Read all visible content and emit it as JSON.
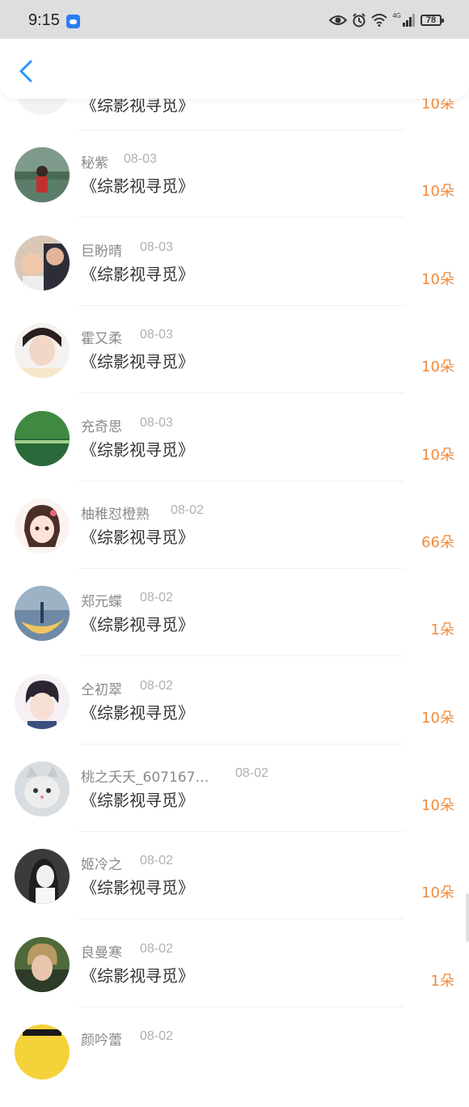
{
  "status_bar": {
    "time": "9:15",
    "battery": "78",
    "network": "4G"
  },
  "nav": {
    "back_icon": "chevron-left-icon"
  },
  "colors": {
    "accent": "#2a95ff",
    "amount": "#f08a3c",
    "name": "#8a8a8a",
    "date": "#b0b0b0"
  },
  "rows": [
    {
      "name": "",
      "date": "",
      "work": "《综影视寻觅》",
      "amount": "10朵"
    },
    {
      "name": "秘紫",
      "date": "08-03",
      "work": "《综影视寻觅》",
      "amount": "10朵"
    },
    {
      "name": "巨盼晴",
      "date": "08-03",
      "work": "《综影视寻觅》",
      "amount": "10朵"
    },
    {
      "name": "霍又柔",
      "date": "08-03",
      "work": "《综影视寻觅》",
      "amount": "10朵"
    },
    {
      "name": "充奇思",
      "date": "08-03",
      "work": "《综影视寻觅》",
      "amount": "10朵"
    },
    {
      "name": "柚稚怼橙熟",
      "date": "08-02",
      "work": "《综影视寻觅》",
      "amount": "66朵"
    },
    {
      "name": "郑元蝶",
      "date": "08-02",
      "work": "《综影视寻觅》",
      "amount": "1朵"
    },
    {
      "name": "仝初翠",
      "date": "08-02",
      "work": "《综影视寻觅》",
      "amount": "10朵"
    },
    {
      "name": "桃之夭夭_607167…",
      "date": "08-02",
      "work": "《综影视寻觅》",
      "amount": "10朵"
    },
    {
      "name": "姬冷之",
      "date": "08-02",
      "work": "《综影视寻觅》",
      "amount": "10朵"
    },
    {
      "name": "良曼寒",
      "date": "08-02",
      "work": "《综影视寻觅》",
      "amount": "1朵"
    },
    {
      "name": "颜吟蕾",
      "date": "08-02",
      "work": "",
      "amount": ""
    }
  ]
}
